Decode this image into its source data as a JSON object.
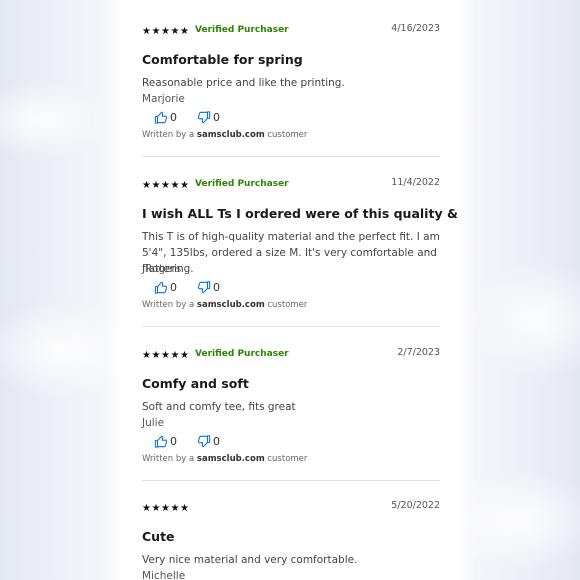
{
  "reviews": [
    {
      "rating": 5,
      "verified": "Verified Purchaser",
      "date": "4/16/2023",
      "title": "Comfortable for spring",
      "body": "Reasonable price and like the printing.",
      "author": "Marjorie",
      "helpful": "0",
      "unhelpful": "0",
      "written_prefix": "Written by a",
      "written_site": "samsclub.com",
      "written_suffix": "customer"
    },
    {
      "rating": 5,
      "verified": "Verified Purchaser",
      "date": "11/4/2022",
      "title": "I wish ALL Ts I ordered were of this quality & fit",
      "body": "This T is of high-quality material and the perfect fit. I am 5'4\", 135lbs, ordered a size M. It's very comfortable and flattering.",
      "author": "JRogers",
      "helpful": "0",
      "unhelpful": "0",
      "written_prefix": "Written by a",
      "written_site": "samsclub.com",
      "written_suffix": "customer"
    },
    {
      "rating": 5,
      "verified": "Verified Purchaser",
      "date": "2/7/2023",
      "title": "Comfy and soft",
      "body": "Soft and comfy tee, fits great",
      "author": "Julie",
      "helpful": "0",
      "unhelpful": "0",
      "written_prefix": "Written by a",
      "written_site": "samsclub.com",
      "written_suffix": "customer"
    },
    {
      "rating": 5,
      "verified": "",
      "date": "5/20/2022",
      "title": "Cute",
      "body": "Very nice material and very comfortable.",
      "author": "Michelle"
    }
  ],
  "colors": {
    "verified_green": "#2a8703",
    "vote_icon_blue": "#0071dc",
    "star_black": "#111111"
  }
}
